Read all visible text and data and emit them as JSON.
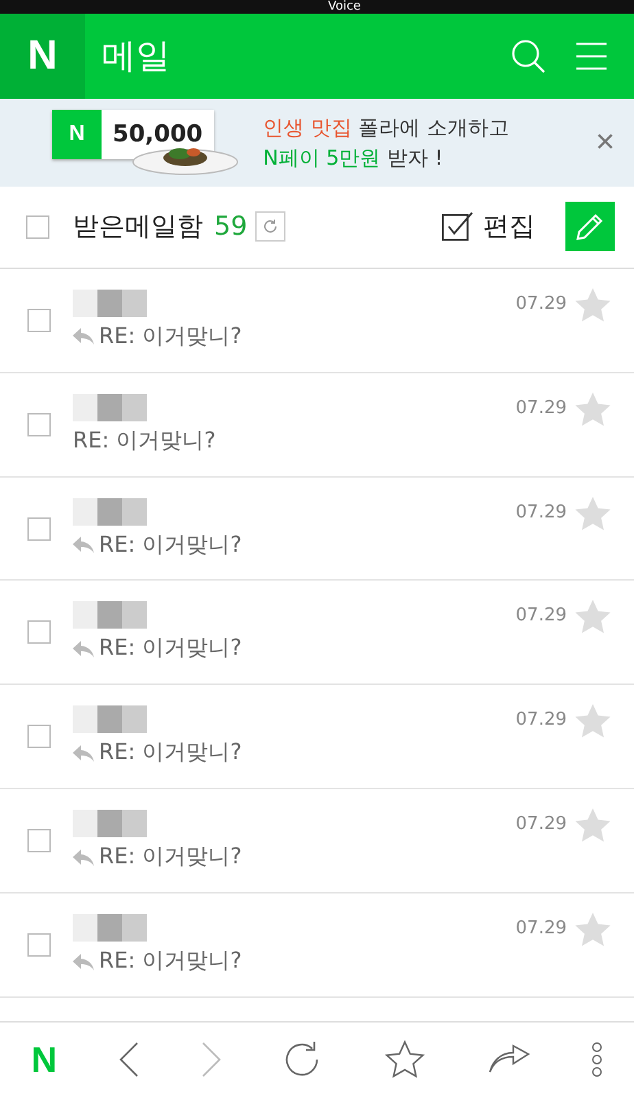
{
  "status_bar": {
    "label": "Voice"
  },
  "header": {
    "logo": "N",
    "title": "메일"
  },
  "banner": {
    "badge_logo": "N",
    "amount": "50,000",
    "line_1": "**인생 맛집** 폴라에 소개하고",
    "line_2": "**N페이 5만원** 받자 !",
    "close": "×"
  },
  "toolbar": {
    "select_all": {
      "checked": false
    },
    "folder": "받은메일함",
    "count": "59",
    "edit": {
      "label": "편집",
      "checked": true
    }
  },
  "mails": [
    {
      "subject": "RE: 이거맞니?",
      "date": "07.29",
      "replied": true,
      "checked": false,
      "starred": false
    },
    {
      "subject": "RE: 이거맞니?",
      "date": "07.29",
      "replied": false,
      "checked": false,
      "starred": false
    },
    {
      "subject": "RE: 이거맞니?",
      "date": "07.29",
      "replied": true,
      "checked": false,
      "starred": false
    },
    {
      "subject": "RE: 이거맞니?",
      "date": "07.29",
      "replied": true,
      "checked": false,
      "starred": false
    },
    {
      "subject": "RE: 이거맞니?",
      "date": "07.29",
      "replied": true,
      "checked": false,
      "starred": false
    },
    {
      "subject": "RE: 이거맞니?",
      "date": "07.29",
      "replied": true,
      "checked": false,
      "starred": false
    },
    {
      "subject": "RE: 이거맞니?",
      "date": "07.29",
      "replied": true,
      "checked": false,
      "starred": false
    }
  ],
  "bottom_nav": {
    "logo": "N"
  }
}
